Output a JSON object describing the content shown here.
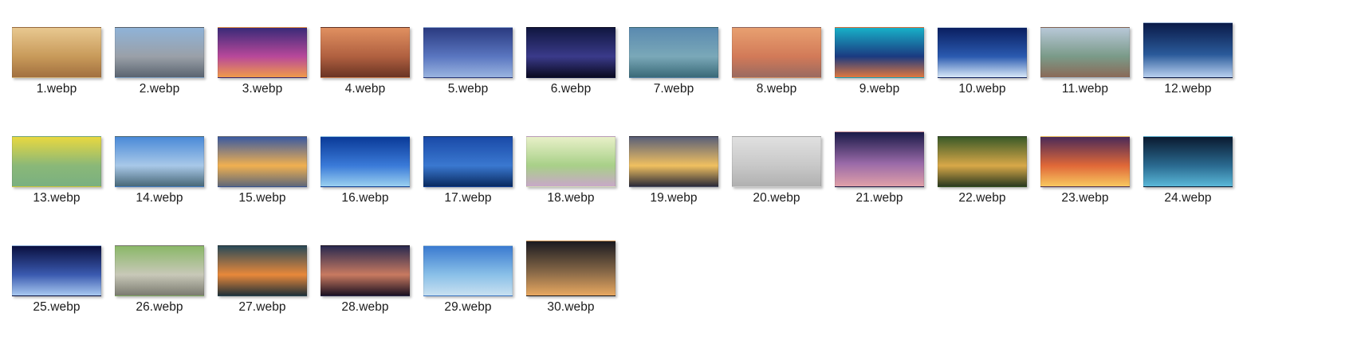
{
  "files": [
    {
      "name": "1.webp",
      "colors": [
        "#e8c890",
        "#c89a5a",
        "#a27040"
      ],
      "tall": false
    },
    {
      "name": "2.webp",
      "colors": [
        "#8fb3d8",
        "#9aa0a8",
        "#5a6470"
      ],
      "tall": false
    },
    {
      "name": "3.webp",
      "colors": [
        "#3a2a78",
        "#b8489a",
        "#f09a4a"
      ],
      "tall": false
    },
    {
      "name": "4.webp",
      "colors": [
        "#e09060",
        "#b06040",
        "#6a3424"
      ],
      "tall": false
    },
    {
      "name": "5.webp",
      "colors": [
        "#2a3a80",
        "#5a76c0",
        "#9ab4e0"
      ],
      "tall": false
    },
    {
      "name": "6.webp",
      "colors": [
        "#101640",
        "#3a3a8a",
        "#0a0a20"
      ],
      "tall": false
    },
    {
      "name": "7.webp",
      "colors": [
        "#5a8ab0",
        "#7aa8b8",
        "#3a6a78"
      ],
      "tall": false
    },
    {
      "name": "8.webp",
      "colors": [
        "#e8a070",
        "#d27a58",
        "#9a6a60"
      ],
      "tall": false
    },
    {
      "name": "9.webp",
      "colors": [
        "#18b0c8",
        "#1a3a80",
        "#e07840"
      ],
      "tall": false
    },
    {
      "name": "10.webp",
      "colors": [
        "#0a1e60",
        "#2a5ab0",
        "#d8e8f8"
      ],
      "tall": false
    },
    {
      "name": "11.webp",
      "colors": [
        "#b8c8d8",
        "#7a9a88",
        "#8a6a58"
      ],
      "tall": false
    },
    {
      "name": "12.webp",
      "colors": [
        "#0a1a48",
        "#2a5a9a",
        "#b8d0f0"
      ],
      "tall": true
    },
    {
      "name": "13.webp",
      "colors": [
        "#e8d840",
        "#8ab878",
        "#7ab080"
      ],
      "tall": false
    },
    {
      "name": "14.webp",
      "colors": [
        "#4a8ad8",
        "#a8c8e8",
        "#486878"
      ],
      "tall": false
    },
    {
      "name": "15.webp",
      "colors": [
        "#3a5aa0",
        "#f0b050",
        "#606878"
      ],
      "tall": false
    },
    {
      "name": "16.webp",
      "colors": [
        "#0a3a98",
        "#3a7ad8",
        "#9ad0f0"
      ],
      "tall": false
    },
    {
      "name": "17.webp",
      "colors": [
        "#1a4aa8",
        "#3a78d0",
        "#0a2a60"
      ],
      "tall": false
    },
    {
      "name": "18.webp",
      "colors": [
        "#e8f0c8",
        "#a8d088",
        "#c8a8c8"
      ],
      "tall": false
    },
    {
      "name": "19.webp",
      "colors": [
        "#5a6078",
        "#f0c060",
        "#2a2a38"
      ],
      "tall": false
    },
    {
      "name": "20.webp",
      "colors": [
        "#e0e0e0",
        "#c8c8c8",
        "#b0b0b0"
      ],
      "tall": false
    },
    {
      "name": "21.webp",
      "colors": [
        "#1a1a48",
        "#9a6aa8",
        "#e0a0a8"
      ],
      "tall": true
    },
    {
      "name": "22.webp",
      "colors": [
        "#3a5a28",
        "#d8a848",
        "#2a3a20"
      ],
      "tall": false
    },
    {
      "name": "23.webp",
      "colors": [
        "#4a2a58",
        "#e06838",
        "#f8c860"
      ],
      "tall": false
    },
    {
      "name": "24.webp",
      "colors": [
        "#0a1a30",
        "#2a6a90",
        "#5ab8d8"
      ],
      "tall": false
    },
    {
      "name": "25.webp",
      "colors": [
        "#0a1040",
        "#3a5ab0",
        "#a8c8f0"
      ],
      "tall": false
    },
    {
      "name": "26.webp",
      "colors": [
        "#8ab868",
        "#c8c8b8",
        "#7a7a70"
      ],
      "tall": false
    },
    {
      "name": "27.webp",
      "colors": [
        "#2a4a58",
        "#e8883a",
        "#203038"
      ],
      "tall": false
    },
    {
      "name": "28.webp",
      "colors": [
        "#2a2a50",
        "#c87a60",
        "#1a1020"
      ],
      "tall": false
    },
    {
      "name": "29.webp",
      "colors": [
        "#3a7ad0",
        "#8ac0e8",
        "#c8e0f0"
      ],
      "tall": false
    },
    {
      "name": "30.webp",
      "colors": [
        "#1a1a20",
        "#8a6a48",
        "#e8a860"
      ],
      "tall": true
    }
  ]
}
